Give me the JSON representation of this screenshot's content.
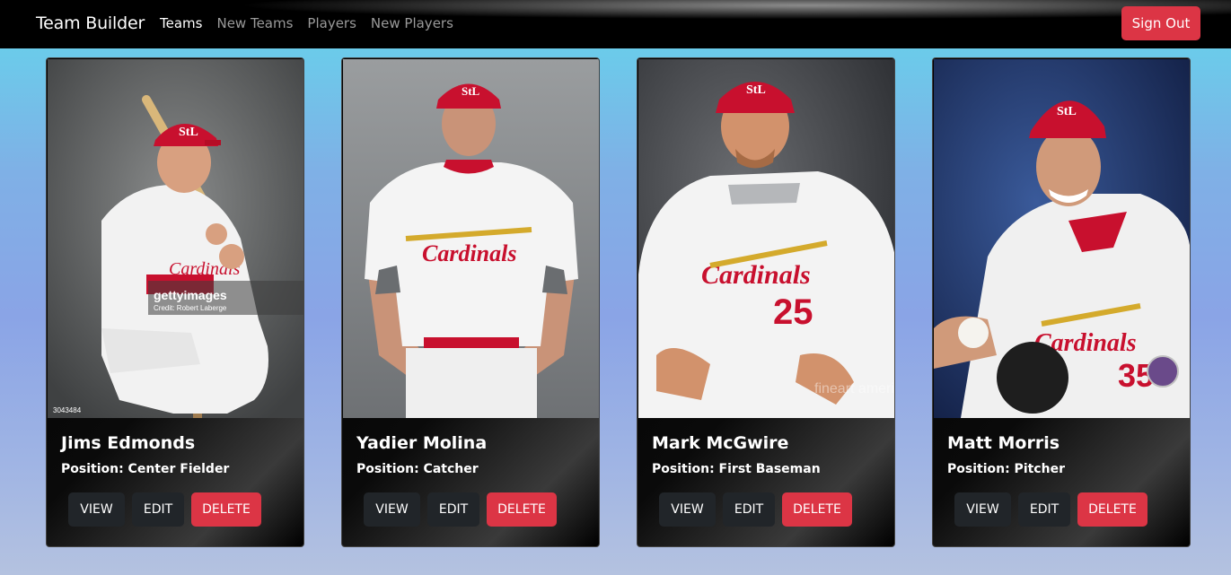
{
  "navbar": {
    "brand": "Team Builder",
    "links": [
      {
        "label": "Teams",
        "active": true
      },
      {
        "label": "New Teams",
        "active": false
      },
      {
        "label": "Players",
        "active": false
      },
      {
        "label": "New Players",
        "active": false
      }
    ],
    "sign_out_label": "Sign Out"
  },
  "players": [
    {
      "name": "Jims Edmonds",
      "position": "Position: Center Fielder",
      "jersey": "",
      "photo_bg": "#6b6d6e",
      "photo_text": "gettyimages",
      "photo_credit": "Credit: Robert Laberge",
      "photo_id": "3043484"
    },
    {
      "name": "Yadier Molina",
      "position": "Position: Catcher",
      "jersey": "",
      "photo_bg": "#8a8d90"
    },
    {
      "name": "Mark McGwire",
      "position": "Position: First Baseman",
      "jersey": "25",
      "photo_bg": "#5a5c60",
      "photo_text": "fineart america"
    },
    {
      "name": "Matt Morris",
      "position": "Position: Pitcher",
      "jersey": "35",
      "photo_bg": "#24366a"
    }
  ],
  "buttons": {
    "view": "VIEW",
    "edit": "EDIT",
    "delete": "DELETE"
  },
  "colors": {
    "danger": "#dc3545",
    "dark": "#212529",
    "cap": "#c8102e"
  }
}
